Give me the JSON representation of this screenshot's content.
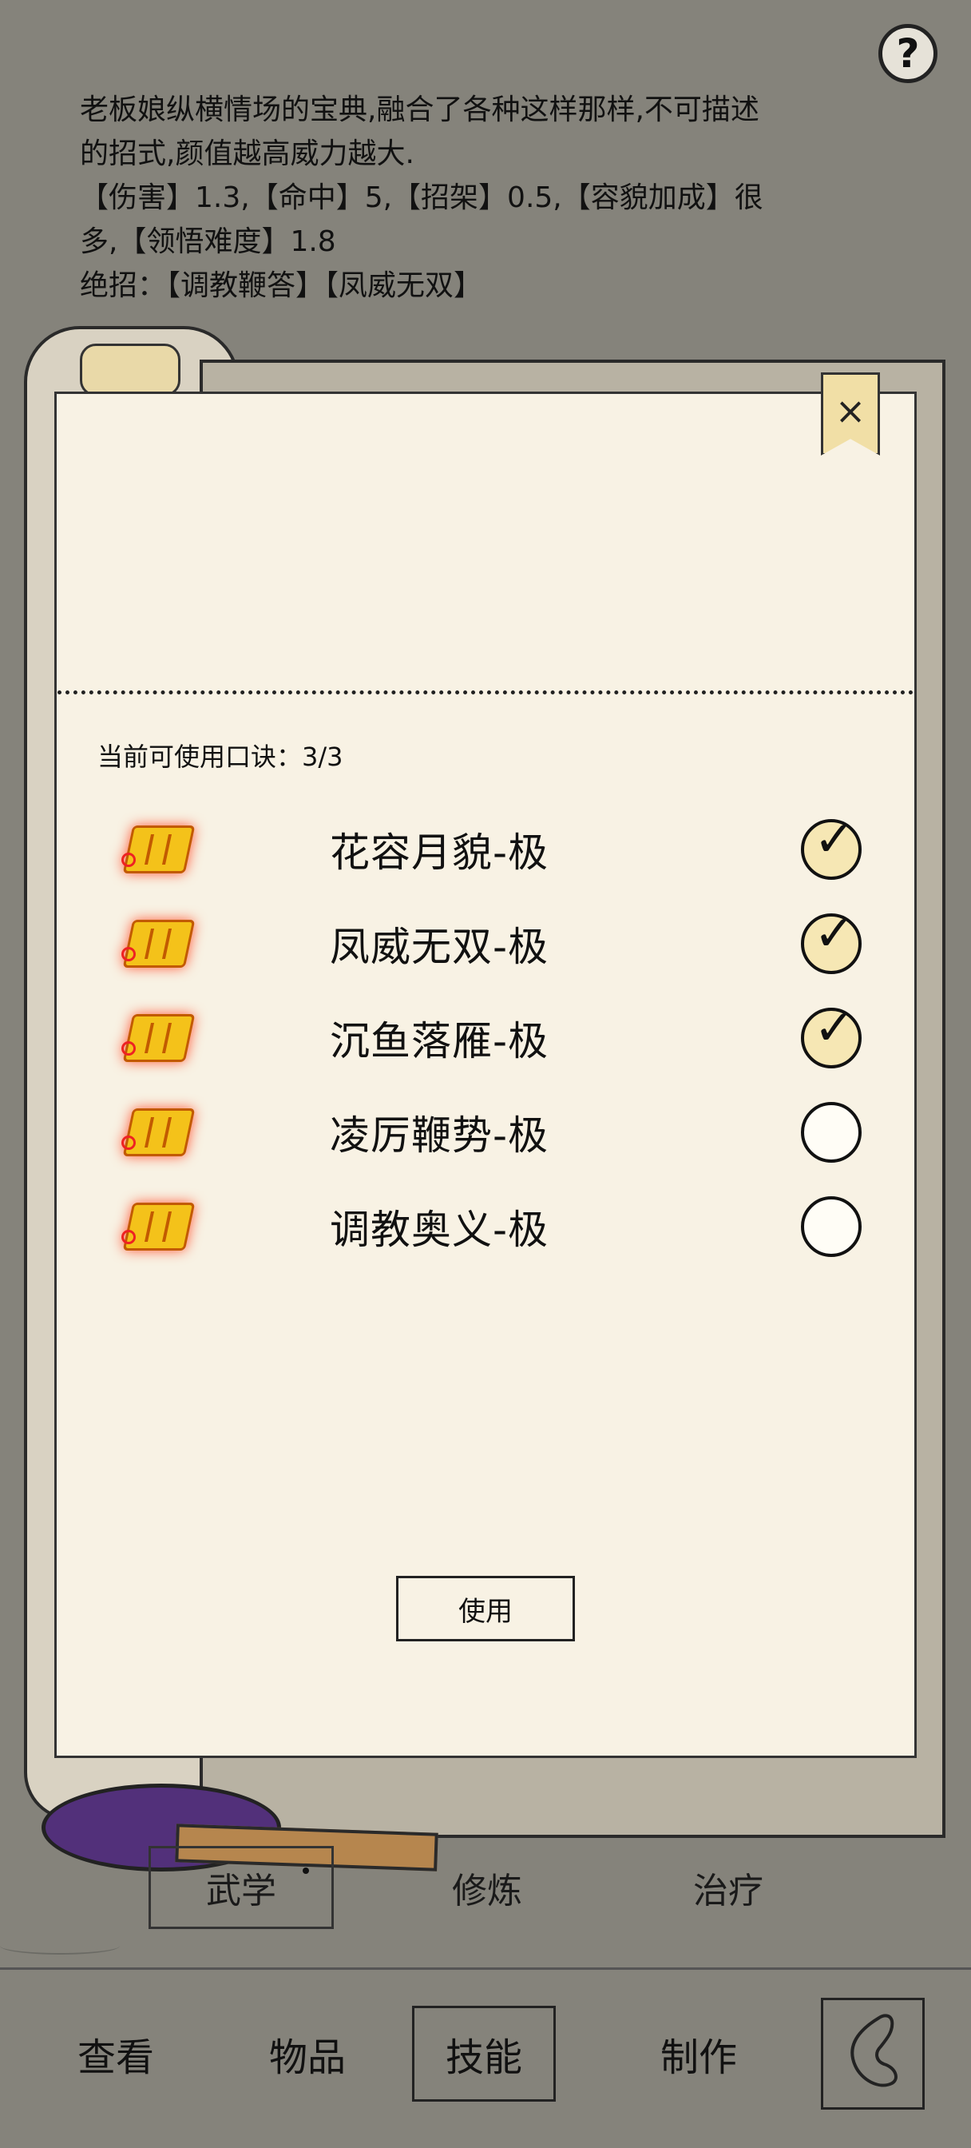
{
  "help": {
    "symbol": "?"
  },
  "description": {
    "line1": "老板娘纵横情场的宝典,融合了各种这样那样,不可描述",
    "line2": "的招式,颜值越高威力越大.",
    "line3": "【伤害】1.3,【命中】5,【招架】0.5,【容貌加成】很",
    "line4": "多,【领悟难度】1.8",
    "line5": "绝招：【调教鞭答】【凤威无双】"
  },
  "panel": {
    "close_symbol": "×",
    "count_label": "当前可使用口诀：3/3",
    "use_button": "使用",
    "mantras": [
      {
        "name": "花容月貌-极",
        "checked": true
      },
      {
        "name": "凤威无双-极",
        "checked": true
      },
      {
        "name": "沉鱼落雁-极",
        "checked": true
      },
      {
        "name": "凌厉鞭势-极",
        "checked": false
      },
      {
        "name": "调教奥义-极",
        "checked": false
      }
    ],
    "check_mark": "✓"
  },
  "subtabs": {
    "wuxue": "武学",
    "xiulian": "修炼",
    "zhiliao": "治疗"
  },
  "nav": {
    "view": "查看",
    "items": "物品",
    "skills": "技能",
    "craft": "制作"
  }
}
